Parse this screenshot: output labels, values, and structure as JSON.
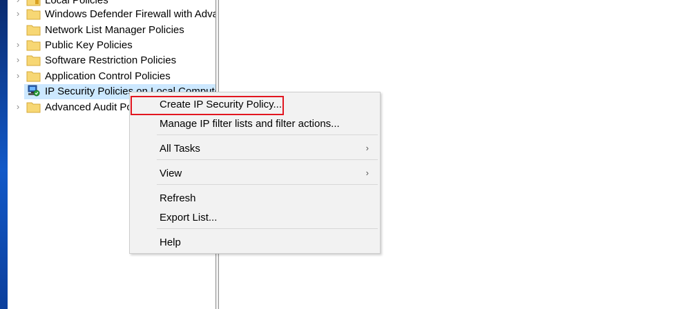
{
  "tree": {
    "items": [
      {
        "label": "Local Policies",
        "expander": "›",
        "icon": "folder-icon"
      },
      {
        "label": "Windows Defender Firewall with Advanced Security",
        "expander": "›",
        "icon": "folder-icon"
      },
      {
        "label": "Network List Manager Policies",
        "expander": "",
        "icon": "folder-icon"
      },
      {
        "label": "Public Key Policies",
        "expander": "›",
        "icon": "folder-icon"
      },
      {
        "label": "Software Restriction Policies",
        "expander": "›",
        "icon": "folder-icon"
      },
      {
        "label": "Application Control Policies",
        "expander": "›",
        "icon": "folder-icon"
      },
      {
        "label": "IP Security Policies on Local Computer",
        "expander": "",
        "icon": "ip-security-policy-icon",
        "selected": true
      },
      {
        "label": "Advanced Audit Policy Configuration",
        "expander": "›",
        "icon": "folder-icon"
      }
    ]
  },
  "context_menu": {
    "items": [
      {
        "label": "Create IP Security Policy..."
      },
      {
        "label": "Manage IP filter lists and filter actions..."
      },
      {
        "label": "All Tasks",
        "submenu_arrow": "›"
      },
      {
        "label": "View",
        "submenu_arrow": "›"
      },
      {
        "label": "Refresh"
      },
      {
        "label": "Export List..."
      },
      {
        "label": "Help"
      }
    ]
  },
  "colors": {
    "selection": "#cce8ff",
    "menu_background": "#f2f2f2",
    "highlight_border": "#e2151f",
    "folder": "#f7d774"
  }
}
